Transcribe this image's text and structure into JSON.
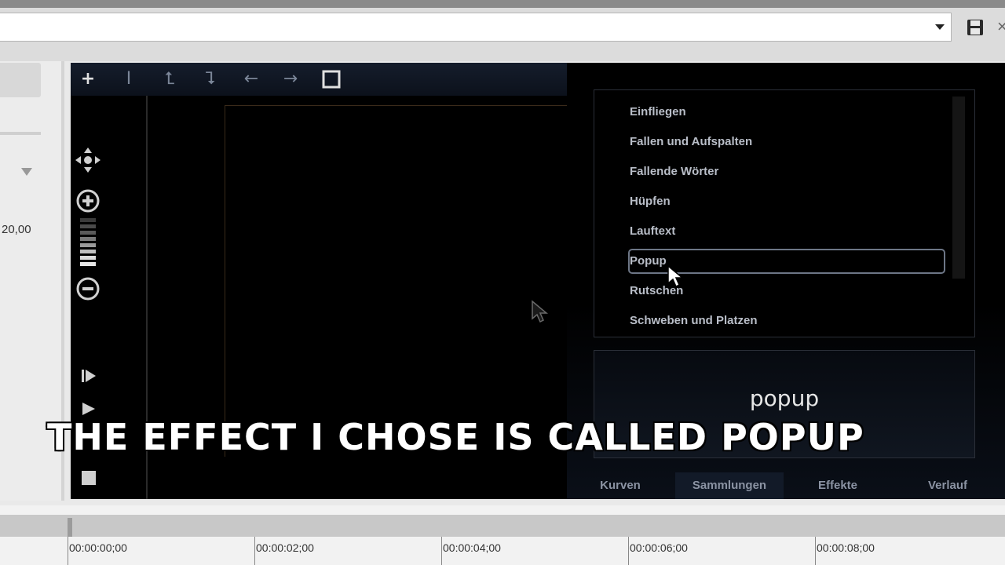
{
  "toolbar": {
    "tools": [
      "plus-icon",
      "text-cursor-icon",
      "corner-up-left-icon",
      "corner-down-right-icon",
      "arrow-left-icon",
      "arrow-right-icon",
      "square-icon"
    ]
  },
  "left_panel": {
    "value": "20,00"
  },
  "effects": {
    "items": [
      "Einfliegen",
      "Fallen und Aufspalten",
      "Fallende Wörter",
      "Hüpfen",
      "Lauftext",
      "Popup",
      "Rutschen",
      "Schweben und Platzen"
    ],
    "selected": "Popup"
  },
  "preview": {
    "text": "popup"
  },
  "tabs": [
    "Kurven",
    "Sammlungen",
    "Effekte",
    "Verlauf"
  ],
  "active_tab": "Sammlungen",
  "caption": "THE EFFECT I CHOSE IS CALLED POPUP",
  "timeline": {
    "labels": [
      "00:00:00;00",
      "00:00:02;00",
      "00:00:04;00",
      "00:00:06;00",
      "00:00:08;00"
    ]
  },
  "colors": {
    "editor_bg": "#000000",
    "list_text": "#b9bec8",
    "tab_text": "#8b93a3",
    "selection_border": "#6d7686"
  }
}
